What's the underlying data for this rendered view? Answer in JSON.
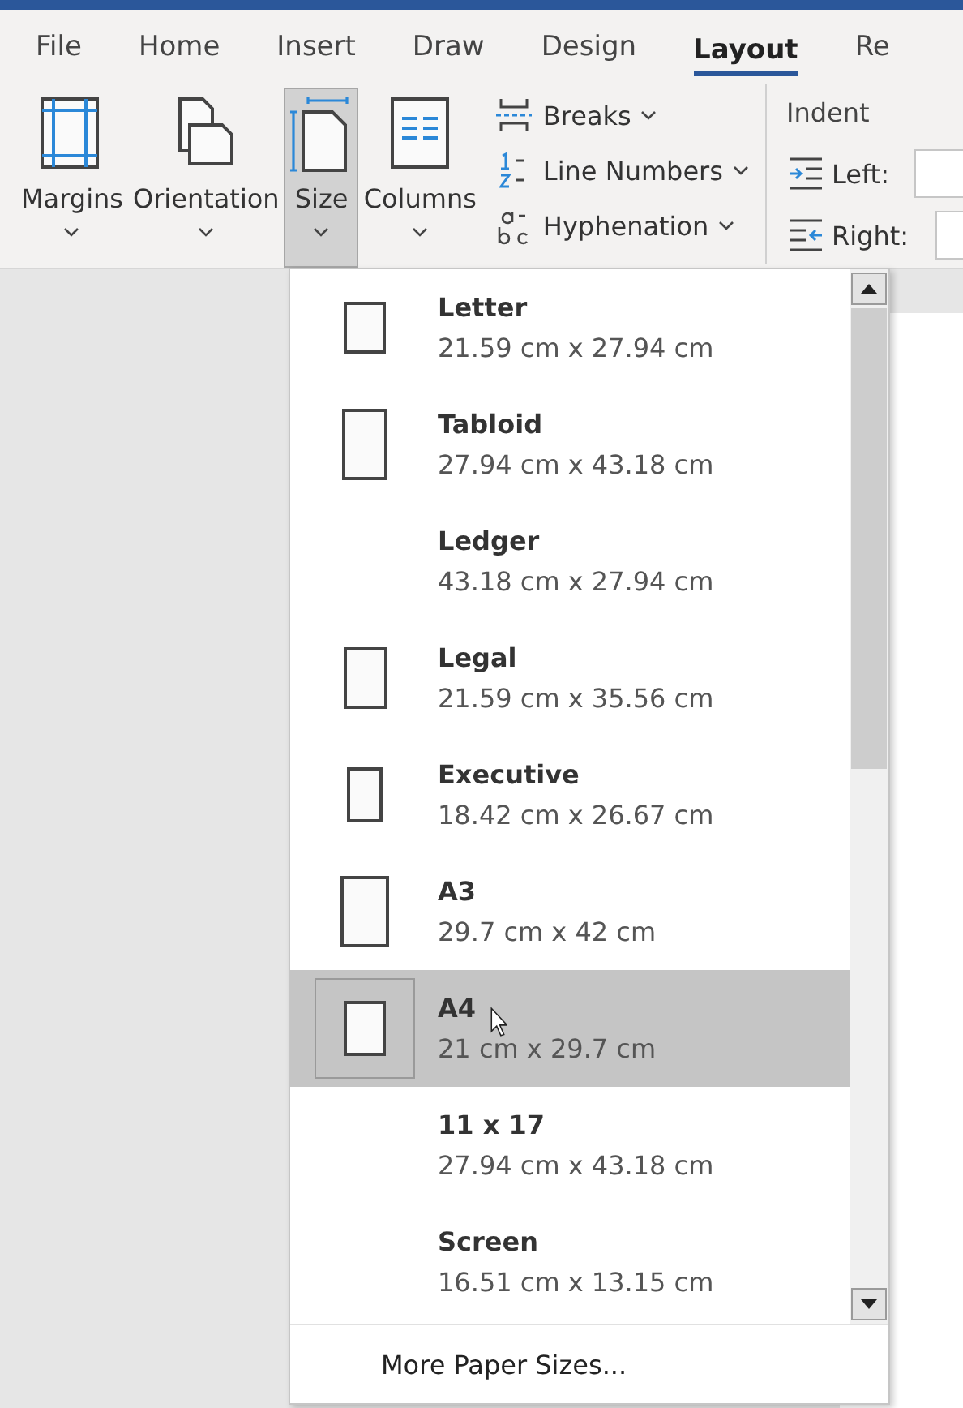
{
  "tabs": [
    {
      "label": "File",
      "selected": false
    },
    {
      "label": "Home",
      "selected": false
    },
    {
      "label": "Insert",
      "selected": false
    },
    {
      "label": "Draw",
      "selected": false
    },
    {
      "label": "Design",
      "selected": false
    },
    {
      "label": "Layout",
      "selected": true
    },
    {
      "label": "Re",
      "selected": false
    }
  ],
  "ribbon": {
    "large_buttons": [
      {
        "kind": "margins",
        "label": "Margins",
        "selected": false
      },
      {
        "kind": "orientation",
        "label": "Orientation",
        "selected": false
      },
      {
        "kind": "size",
        "label": "Size",
        "selected": true
      },
      {
        "kind": "columns",
        "label": "Columns",
        "selected": false
      }
    ],
    "small_buttons": [
      {
        "kind": "breaks",
        "label": "Breaks"
      },
      {
        "kind": "line_numbers",
        "label": "Line Numbers"
      },
      {
        "kind": "hyphenation",
        "label": "Hyphenation"
      }
    ],
    "indent": {
      "title": "Indent",
      "fields": [
        {
          "kind": "left",
          "label": "Left:"
        },
        {
          "kind": "right",
          "label": "Right:"
        }
      ]
    }
  },
  "size_menu": {
    "items": [
      {
        "name": "Letter",
        "dimensions": "21.59 cm x 27.94 cm",
        "icon": true,
        "selected": false
      },
      {
        "name": "Tabloid",
        "dimensions": "27.94 cm x 43.18 cm",
        "icon": true,
        "selected": false
      },
      {
        "name": "Ledger",
        "dimensions": "43.18 cm x 27.94 cm",
        "icon": false,
        "selected": false
      },
      {
        "name": "Legal",
        "dimensions": "21.59 cm x 35.56 cm",
        "icon": true,
        "selected": false
      },
      {
        "name": "Executive",
        "dimensions": "18.42 cm x 26.67 cm",
        "icon": true,
        "selected": false
      },
      {
        "name": "A3",
        "dimensions": "29.7 cm x 42 cm",
        "icon": true,
        "selected": false
      },
      {
        "name": "A4",
        "dimensions": "21 cm x 29.7 cm",
        "icon": true,
        "selected": true
      },
      {
        "name": "11 x 17",
        "dimensions": "27.94 cm x 43.18 cm",
        "icon": false,
        "selected": false
      },
      {
        "name": "Screen",
        "dimensions": "16.51 cm x 13.15 cm",
        "icon": false,
        "selected": false
      }
    ],
    "more": "More Paper Sizes..."
  }
}
